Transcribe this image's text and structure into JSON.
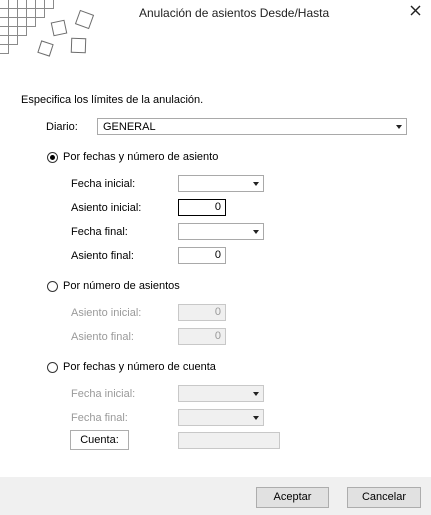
{
  "window": {
    "title": "Anulación de asientos Desde/Hasta",
    "close_icon": "close-icon"
  },
  "intro": "Especifica los límites de la anulación.",
  "diario": {
    "label": "Diario:",
    "value": "GENERAL"
  },
  "option_fechas_asiento": {
    "label": "Por fechas y número de asiento",
    "selected": true,
    "fecha_inicial_label": "Fecha inicial:",
    "fecha_inicial_value": "",
    "asiento_inicial_label": "Asiento inicial:",
    "asiento_inicial_value": "0",
    "fecha_final_label": "Fecha final:",
    "fecha_final_value": "",
    "asiento_final_label": "Asiento final:",
    "asiento_final_value": "0"
  },
  "option_numero_asientos": {
    "label": "Por número de asientos",
    "selected": false,
    "asiento_inicial_label": "Asiento inicial:",
    "asiento_inicial_value": "0",
    "asiento_final_label": "Asiento final:",
    "asiento_final_value": "0"
  },
  "option_fechas_cuenta": {
    "label": "Por fechas y número de cuenta",
    "selected": false,
    "fecha_inicial_label": "Fecha inicial:",
    "fecha_inicial_value": "",
    "fecha_final_label": "Fecha final:",
    "fecha_final_value": "",
    "cuenta_button": "Cuenta:",
    "cuenta_value": ""
  },
  "footer": {
    "accept_label": "Aceptar",
    "cancel_label": "Cancelar"
  }
}
